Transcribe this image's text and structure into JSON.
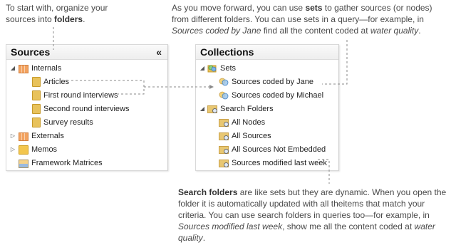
{
  "notes": {
    "left": {
      "p1": "To start with, organize your sources into ",
      "b1": "folders",
      "p2": "."
    },
    "top": {
      "p1": "As you move forward, you can use ",
      "b1": "sets",
      "p2": " to gather sources (or nodes) from different folders. You can use sets in a query—for example, in ",
      "i1": "Sources coded by Jane",
      "p3": " find all the content coded at ",
      "i2": "water quality",
      "p4": "."
    },
    "bottom": {
      "b1": "Search folders",
      "p1": " are like sets but they are dynamic. When you open the folder it is automatically updated with all theitems that match your criteria. You can use search folders in queries  too—for example, in ",
      "i1": "Sources  modified last week",
      "p2": ", show me all the content coded at ",
      "i2": "water quality",
      "p3": "."
    }
  },
  "sources_panel": {
    "title": "Sources",
    "collapse": "«",
    "items": [
      {
        "label": "Internals",
        "expander": "◢"
      },
      {
        "label": "Articles"
      },
      {
        "label": "First round interviews"
      },
      {
        "label": "Second round interviews"
      },
      {
        "label": "Survey results"
      },
      {
        "label": "Externals",
        "expander": "▷"
      },
      {
        "label": "Memos",
        "expander": "▷"
      },
      {
        "label": "Framework Matrices"
      }
    ]
  },
  "collections_panel": {
    "title": "Collections",
    "items": [
      {
        "label": "Sets",
        "expander": "◢"
      },
      {
        "label": "Sources coded by Jane"
      },
      {
        "label": "Sources coded by Michael"
      },
      {
        "label": "Search Folders",
        "expander": "◢"
      },
      {
        "label": "All Nodes"
      },
      {
        "label": "All Sources"
      },
      {
        "label": "All Sources Not Embedded"
      },
      {
        "label": "Sources modified last week"
      }
    ]
  },
  "colors": {
    "connector": "#8a8a8a",
    "panel_border": "#d9d9d9",
    "text": "#404040"
  }
}
